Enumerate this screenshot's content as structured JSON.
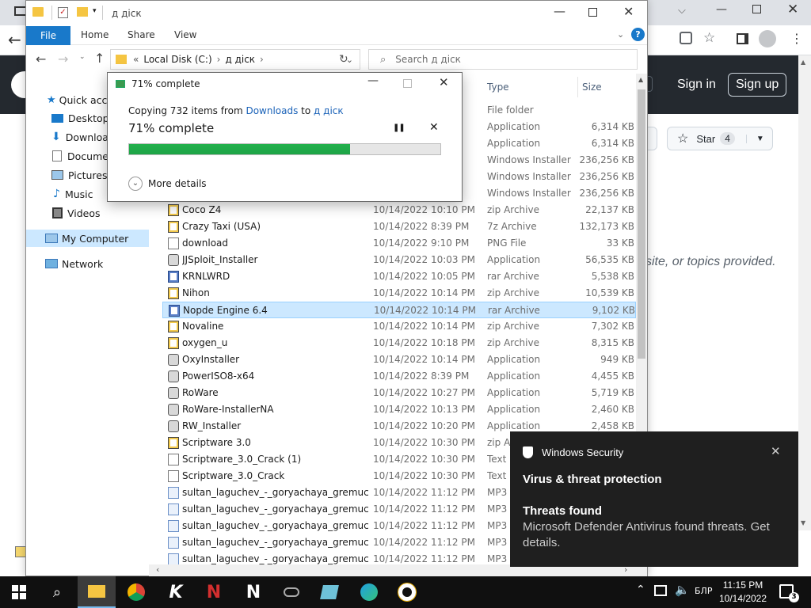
{
  "browser": {
    "gh_sign_in": "Sign in",
    "gh_sign_up": "Sign up",
    "gh_star_label": "Star",
    "gh_star_count": "4",
    "gh_body_text": "site, or topics provided."
  },
  "explorer": {
    "title": "д діск",
    "ribbon": {
      "file": "File",
      "home": "Home",
      "share": "Share",
      "view": "View"
    },
    "address": {
      "root": "Local Disk (C:)",
      "folder": "д діск"
    },
    "search_placeholder": "Search д діск",
    "nav": {
      "quick_access": "Quick access",
      "desktop": "Desktop",
      "downloads": "Downloads",
      "documents": "Documents",
      "pictures": "Pictures",
      "music": "Music",
      "videos": "Videos",
      "my_computer": "My Computer",
      "network": "Network"
    },
    "columns": {
      "type": "Type",
      "size": "Size"
    },
    "top_rows": [
      {
        "type": "File folder",
        "size": ""
      },
      {
        "type": "Application",
        "size": "6,314 KB"
      },
      {
        "type": "Application",
        "size": "6,314 KB"
      },
      {
        "type": "Windows Installer ...",
        "size": "236,256 KB"
      },
      {
        "type": "Windows Installer ...",
        "size": "236,256 KB"
      },
      {
        "type": "Windows Installer ...",
        "size": "236,256 KB"
      }
    ],
    "rows": [
      {
        "name": "Coco Z4",
        "date": "10/14/2022 10:10 PM",
        "type": "zip Archive",
        "size": "22,137 KB",
        "icon": "zip-icon"
      },
      {
        "name": "Crazy Taxi (USA)",
        "date": "10/14/2022 8:39 PM",
        "type": "7z Archive",
        "size": "132,173 KB",
        "icon": "zip-icon"
      },
      {
        "name": "download",
        "date": "10/14/2022 9:10 PM",
        "type": "PNG File",
        "size": "33 KB",
        "icon": "png-icon"
      },
      {
        "name": "JJSploit_Installer",
        "date": "10/14/2022 10:03 PM",
        "type": "Application",
        "size": "56,535 KB",
        "icon": "app-icon"
      },
      {
        "name": "KRNLWRD",
        "date": "10/14/2022 10:05 PM",
        "type": "rar Archive",
        "size": "5,538 KB",
        "icon": "rar-icon"
      },
      {
        "name": "Nihon",
        "date": "10/14/2022 10:14 PM",
        "type": "zip Archive",
        "size": "10,539 KB",
        "icon": "zip-icon"
      },
      {
        "name": "Nopde Engine 6.4",
        "date": "10/14/2022 10:14 PM",
        "type": "rar Archive",
        "size": "9,102 KB",
        "icon": "rar-icon"
      },
      {
        "name": "Novaline",
        "date": "10/14/2022 10:14 PM",
        "type": "zip Archive",
        "size": "7,302 KB",
        "icon": "zip-icon"
      },
      {
        "name": "oxygen_u",
        "date": "10/14/2022 10:18 PM",
        "type": "zip Archive",
        "size": "8,315 KB",
        "icon": "zip-icon"
      },
      {
        "name": "OxyInstaller",
        "date": "10/14/2022 10:14 PM",
        "type": "Application",
        "size": "949 KB",
        "icon": "app-icon"
      },
      {
        "name": "PowerISO8-x64",
        "date": "10/14/2022 8:39 PM",
        "type": "Application",
        "size": "4,455 KB",
        "icon": "app-icon"
      },
      {
        "name": "RoWare",
        "date": "10/14/2022 10:27 PM",
        "type": "Application",
        "size": "5,719 KB",
        "icon": "app-icon"
      },
      {
        "name": "RoWare-InstallerNA",
        "date": "10/14/2022 10:13 PM",
        "type": "Application",
        "size": "2,460 KB",
        "icon": "app-icon"
      },
      {
        "name": "RW_Installer",
        "date": "10/14/2022 10:20 PM",
        "type": "Application",
        "size": "2,458 KB",
        "icon": "app-icon"
      },
      {
        "name": "Scriptware 3.0",
        "date": "10/14/2022 10:30 PM",
        "type": "zip Ar",
        "size": "",
        "icon": "zip-icon"
      },
      {
        "name": "Scriptware_3.0_Crack (1)",
        "date": "10/14/2022 10:30 PM",
        "type": "Text D",
        "size": "",
        "icon": "txt-icon"
      },
      {
        "name": "Scriptware_3.0_Crack",
        "date": "10/14/2022 10:30 PM",
        "type": "Text D",
        "size": "",
        "icon": "txt-icon"
      },
      {
        "name": "sultan_laguchev_-_goryachaya_gremuch...",
        "date": "10/14/2022 11:12 PM",
        "type": "MP3",
        "size": "",
        "icon": "mp3-icon"
      },
      {
        "name": "sultan_laguchev_-_goryachaya_gremuch...",
        "date": "10/14/2022 11:12 PM",
        "type": "MP3",
        "size": "",
        "icon": "mp3-icon"
      },
      {
        "name": "sultan_laguchev_-_goryachaya_gremuch...",
        "date": "10/14/2022 11:12 PM",
        "type": "MP3",
        "size": "",
        "icon": "mp3-icon"
      },
      {
        "name": "sultan_laguchev_-_goryachaya_gremuch...",
        "date": "10/14/2022 11:12 PM",
        "type": "MP3",
        "size": "",
        "icon": "mp3-icon"
      },
      {
        "name": "sultan_laguchev_-_goryachaya_gremuch...",
        "date": "10/14/2022 11:12 PM",
        "type": "MP3",
        "size": "",
        "icon": "mp3-icon"
      }
    ],
    "selected_row": "Nopde Engine 6.4"
  },
  "copy_dialog": {
    "title": "71% complete",
    "line_prefix": "Copying 732 items from ",
    "source": "Downloads",
    "to": " to ",
    "dest": "д діск",
    "status": "71% complete",
    "progress": 0.71,
    "more_details": "More details"
  },
  "toast": {
    "app": "Windows Security",
    "heading": "Virus & threat protection",
    "title": "Threats found",
    "body": "Microsoft Defender Antivirus found threats. Get details."
  },
  "taskbar": {
    "language": "БЛР",
    "time": "11:15 PM",
    "date": "10/14/2022",
    "notification_count": "3"
  },
  "colors": {
    "accent": "#1979ca",
    "progress": "#22b14c",
    "selection": "#cce8ff",
    "github_header": "#24292f"
  }
}
